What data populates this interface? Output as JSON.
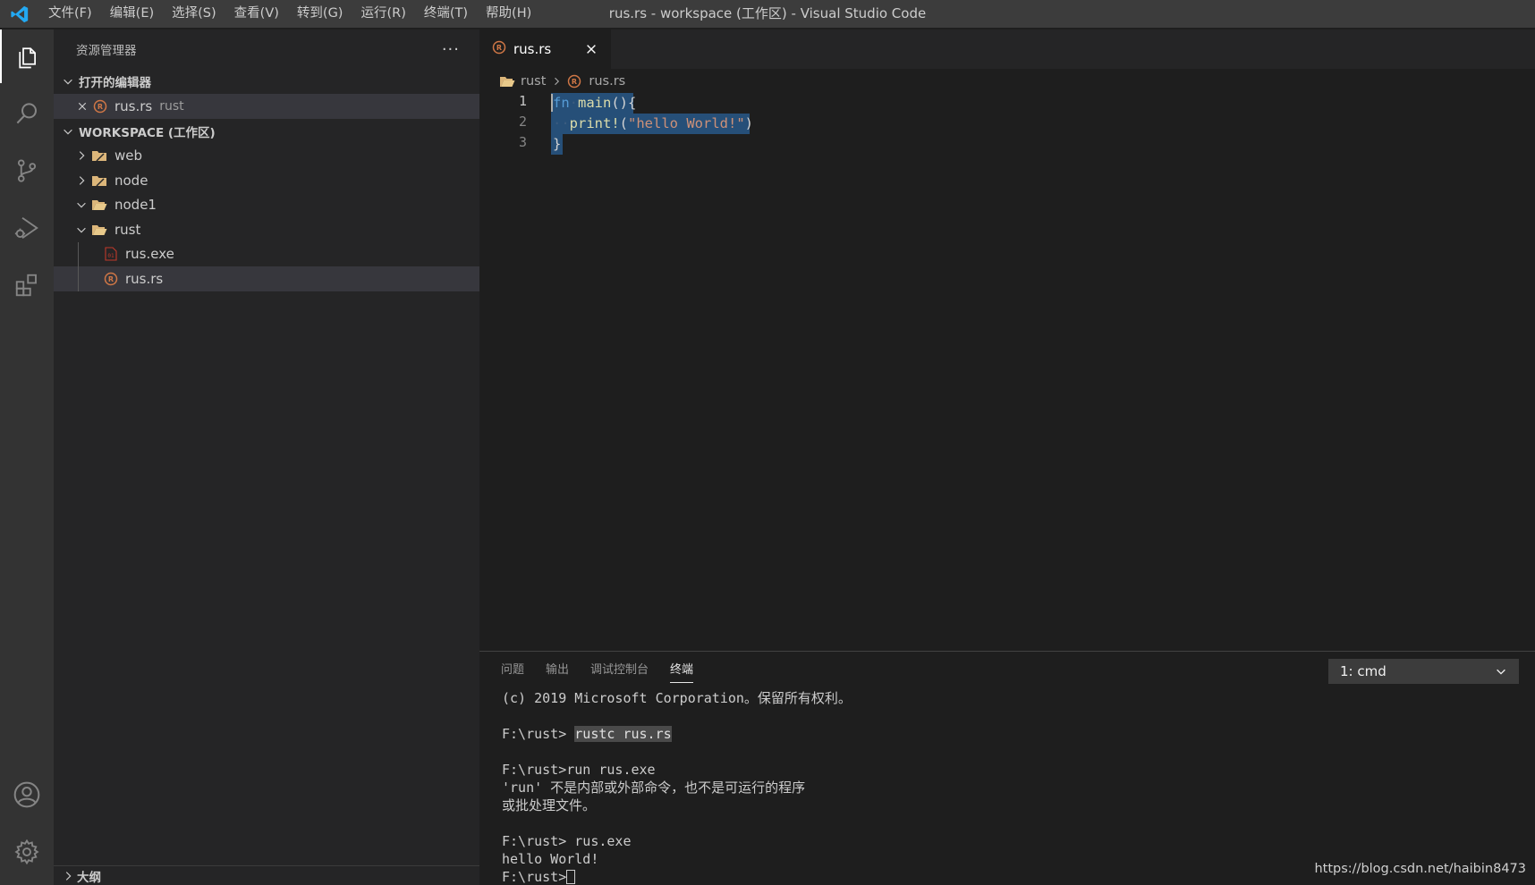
{
  "window": {
    "title": "rus.rs - workspace (工作区) - Visual Studio Code"
  },
  "menu": [
    "文件(F)",
    "编辑(E)",
    "选择(S)",
    "查看(V)",
    "转到(G)",
    "运行(R)",
    "终端(T)",
    "帮助(H)"
  ],
  "activity_bar": {
    "items": [
      "explorer-icon",
      "search-icon",
      "source-control-icon",
      "run-debug-icon",
      "extensions-icon"
    ],
    "bottom": [
      "account-icon",
      "settings-gear-icon"
    ]
  },
  "sidebar": {
    "title": "资源管理器",
    "more": "···",
    "open_editors": {
      "header": "打开的编辑器",
      "items": [
        {
          "name": "rus.rs",
          "desc": "rust"
        }
      ]
    },
    "workspace": {
      "header": "WORKSPACE (工作区)",
      "folders": [
        {
          "name": "web",
          "expanded": false
        },
        {
          "name": "node",
          "expanded": false
        },
        {
          "name": "node1",
          "expanded": true
        },
        {
          "name": "rust",
          "expanded": true
        }
      ],
      "files": [
        {
          "name": "rus.exe"
        },
        {
          "name": "rus.rs"
        }
      ]
    },
    "outline": {
      "header": "大纲"
    }
  },
  "editor": {
    "tab": {
      "label": "rus.rs"
    },
    "breadcrumb": {
      "folder": "rust",
      "file": "rus.rs"
    },
    "lines": [
      {
        "number": "1"
      },
      {
        "number": "2"
      },
      {
        "number": "3"
      }
    ],
    "code": {
      "line1_kw": "fn",
      "line1_fn": "main",
      "line1_rest": "(){",
      "line2_fn": "print!",
      "line2_open": "(",
      "line2_str": "\"hello World!\"",
      "line2_close": ")",
      "line3": "}"
    }
  },
  "panel": {
    "tabs": [
      "问题",
      "输出",
      "调试控制台",
      "终端"
    ],
    "active_tab": "终端",
    "terminal_select": "1: cmd",
    "terminal": {
      "line1": "(c) 2019 Microsoft Corporation。保留所有权利。",
      "prompt1": "F:\\rust> ",
      "cmd1": "rustc rus.rs",
      "line3": "F:\\rust>run rus.exe",
      "line4": "'run' 不是内部或外部命令，也不是可运行的程序",
      "line5": "或批处理文件。",
      "line6": "F:\\rust> rus.exe",
      "line7": "hello World!",
      "prompt_last": "F:\\rust>"
    }
  },
  "watermark": "https://blog.csdn.net/haibin8473",
  "colors": {
    "accent_blue": "#23a9f2",
    "selection": "#264f78",
    "rust_icon": "#d07746",
    "folder": "#dcb67a"
  }
}
